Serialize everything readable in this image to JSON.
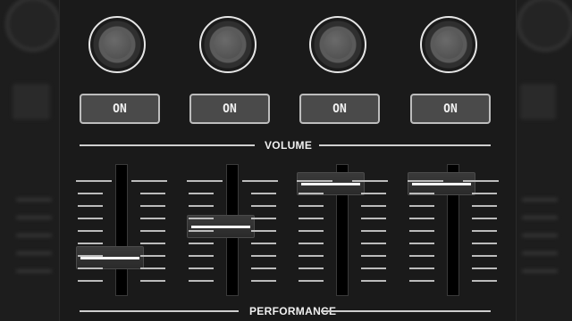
{
  "colors": {
    "panel_bg": "#1a1a1a",
    "button_bg": "#4a4a4a",
    "line": "#cfcfcf",
    "text": "#f0f0f0"
  },
  "channels": [
    {
      "knob_icon": "knob-icon",
      "on_label": "ON",
      "fader_level": 0.22
    },
    {
      "knob_icon": "knob-icon",
      "on_label": "ON",
      "fader_level": 0.52
    },
    {
      "knob_icon": "knob-icon",
      "on_label": "ON",
      "fader_level": 0.92
    },
    {
      "knob_icon": "knob-icon",
      "on_label": "ON",
      "fader_level": 0.92
    }
  ],
  "sections": {
    "volume_label": "VOLUME",
    "performance_label": "PERFORMANCE"
  }
}
